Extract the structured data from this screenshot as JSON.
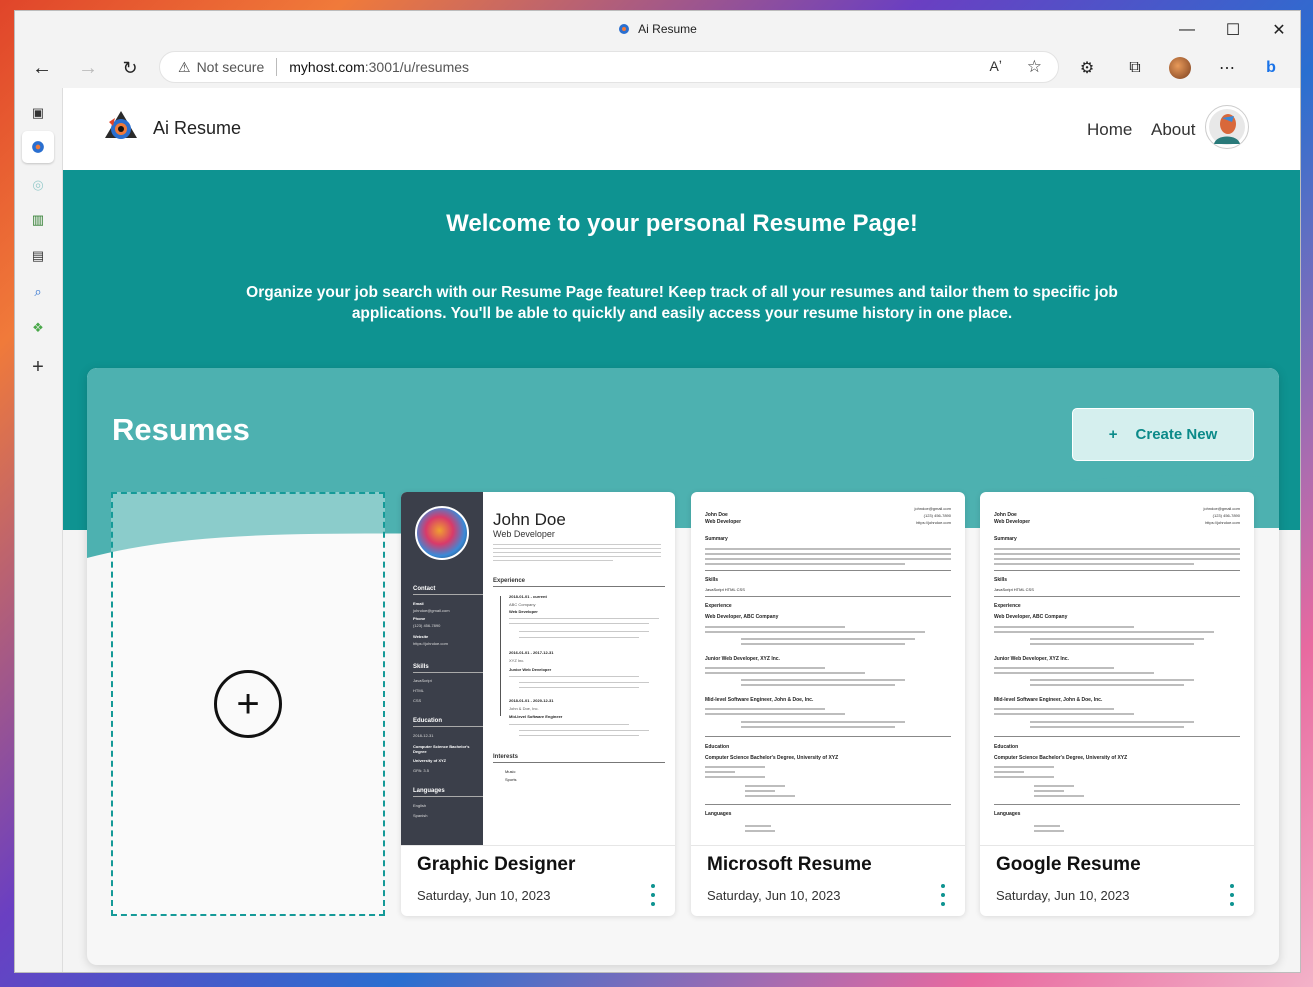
{
  "browser": {
    "window_title": "Ai Resume",
    "security": "Not secure",
    "url_host": "myhost.com",
    "url_rest": ":3001/u/resumes",
    "read_aloud": "Aͅ"
  },
  "app": {
    "brand": "Ai Resume",
    "nav": {
      "home": "Home",
      "about": "About"
    }
  },
  "hero": {
    "title": "Welcome to your personal Resume Page!",
    "subtitle": "Organize your job search with our Resume Page feature! Keep track of all your resumes and tailor them to specific job applications. You'll be able to quickly and easily access your resume history in one place."
  },
  "resumes": {
    "heading": "Resumes",
    "create_plus": "+",
    "create_label": "Create New",
    "new_card_plus": "+",
    "cards": [
      {
        "title": "Graphic Designer",
        "date": "Saturday, Jun 10, 2023"
      },
      {
        "title": "Microsoft Resume",
        "date": "Saturday, Jun 10, 2023"
      },
      {
        "title": "Google Resume",
        "date": "Saturday, Jun 10, 2023"
      }
    ]
  },
  "thumb_dark": {
    "name": "John Doe",
    "role": "Web Developer",
    "contact": "Contact",
    "email_label": "Email",
    "email": "johndoe@gmail.com",
    "phone_label": "Phone",
    "phone": "(123) 456-7890",
    "website_label": "Website",
    "website": "https://johndoe.com",
    "skills": "Skills",
    "skill_items": [
      "JavaScript",
      "HTML",
      "CSS"
    ],
    "education": "Education",
    "edu_dates": "2018-12-31",
    "edu_degree": "Computer Science Bachelor's Degree",
    "edu_school": "University of XYZ",
    "edu_gpa": "GPA: 3.5",
    "languages": "Languages",
    "lang_items": [
      "English",
      "Spanish"
    ],
    "experience": "Experience",
    "jobs": [
      {
        "dates": "2018-01-01 - current",
        "company": "ABC Company",
        "title": "Web Developer"
      },
      {
        "dates": "2016-01-01 - 2017-12-31",
        "company": "XYZ Inc.",
        "title": "Junior Web Developer"
      },
      {
        "dates": "2018-01-01 - 2020-12-31",
        "company": "John & Doe, Inc.",
        "title": "Mid-level Software Engineer"
      }
    ],
    "interests": "Interests",
    "interest_items": [
      "Music",
      "Sports"
    ]
  },
  "thumb_plain": {
    "name": "John Doe",
    "role": "Web Developer",
    "email": "johndoe@gmail.com",
    "phone": "(123) 456-7890",
    "website": "https://johndoe.com",
    "summary": "Summary",
    "skills": "Skills",
    "skill_line": "JavaScript   HTML   CSS",
    "experience": "Experience",
    "job1": "Web Developer, ABC Company",
    "job2": "Junior Web Developer, XYZ Inc.",
    "job3": "Mid-level Software Engineer, John & Doe, Inc.",
    "education": "Education",
    "edu": "Computer Science Bachelor's Degree, University of XYZ",
    "languages": "Languages"
  },
  "colors": {
    "teal": "#0e9391",
    "teal_light": "#4db1b0",
    "button_bg": "#d5efee"
  }
}
